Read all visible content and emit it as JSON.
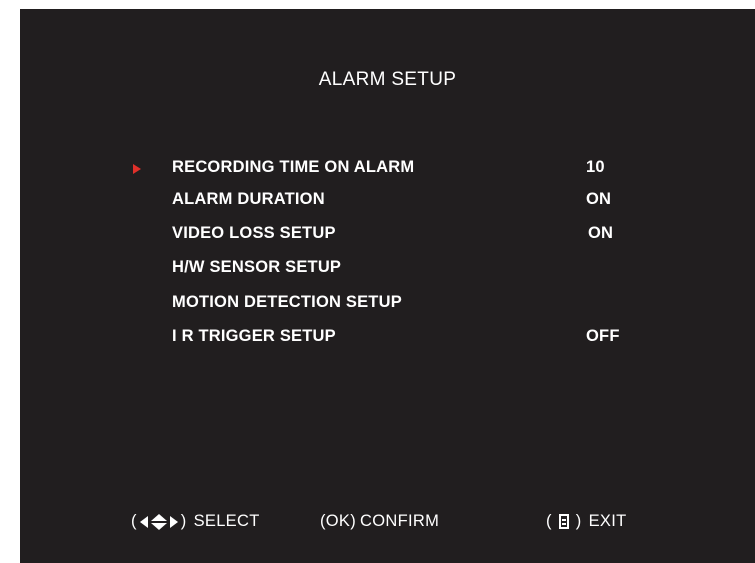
{
  "title": "ALARM SETUP",
  "colors": {
    "background": "#211e1f",
    "text": "#ffffff",
    "pointer": "#e0302a"
  },
  "menu": {
    "items": [
      {
        "label": "RECORDING TIME ON ALARM",
        "value": "10",
        "selected": true
      },
      {
        "label": "ALARM DURATION",
        "value": "ON",
        "selected": false
      },
      {
        "label": "VIDEO LOSS SETUP",
        "value": "ON",
        "selected": false
      },
      {
        "label": "H/W SENSOR SETUP",
        "value": "",
        "selected": false
      },
      {
        "label": "MOTION DETECTION SETUP",
        "value": "",
        "selected": false
      },
      {
        "label": "I R TRIGGER SETUP",
        "value": "OFF",
        "selected": false
      }
    ]
  },
  "footer": {
    "select": {
      "open": "(",
      "close": ")",
      "label": "SELECT",
      "icon": "direction-arrows-icon"
    },
    "confirm": {
      "key": "(OK)",
      "label": "CONFIRM"
    },
    "exit": {
      "open": "(",
      "close": ")",
      "label": "EXIT",
      "icon": "menu-icon"
    }
  }
}
